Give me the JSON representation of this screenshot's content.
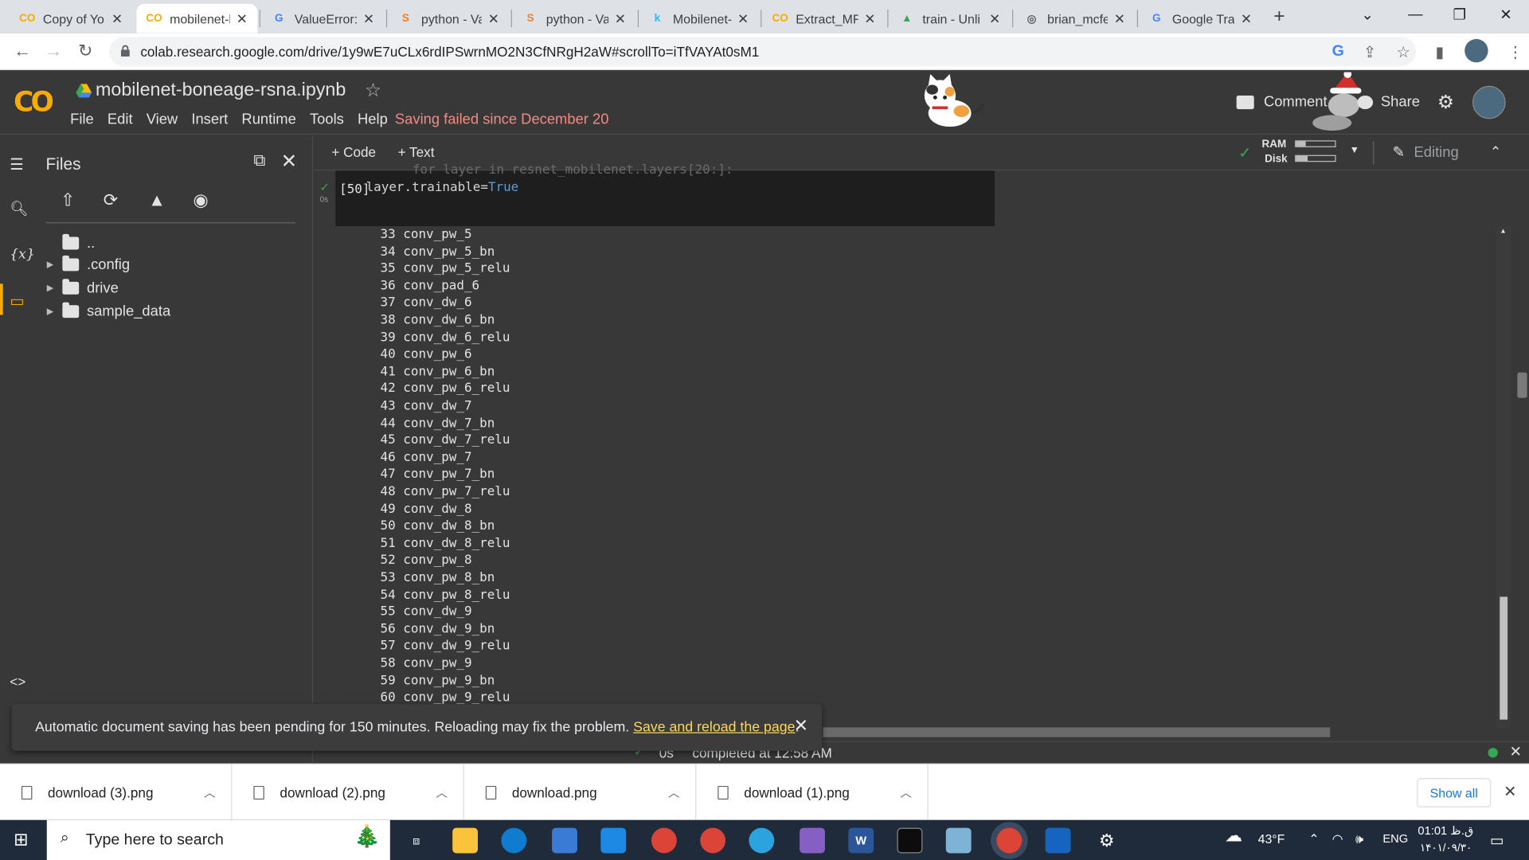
{
  "browser": {
    "tabs": [
      {
        "title": "Copy of Yo",
        "fav": "CO",
        "color": "#f9ab00"
      },
      {
        "title": "mobilenet-b",
        "fav": "CO",
        "color": "#f9ab00"
      },
      {
        "title": "ValueError:",
        "fav": "G",
        "color": "#4285f4"
      },
      {
        "title": "python - Va",
        "fav": "S",
        "color": "#f48024"
      },
      {
        "title": "python - Va",
        "fav": "S",
        "color": "#f48024"
      },
      {
        "title": "Mobilenet-b",
        "fav": "k",
        "color": "#20beff"
      },
      {
        "title": "Extract_MF",
        "fav": "CO",
        "color": "#f9ab00"
      },
      {
        "title": "train - Unli",
        "fav": "▲",
        "color": "#34a853"
      },
      {
        "title": "brian_mcfe",
        "fav": "◎",
        "color": "#5f6368"
      },
      {
        "title": "Google Tra",
        "fav": "G",
        "color": "#4285f4"
      }
    ],
    "url": "colab.research.google.com/drive/1y9wE7uCLx6rdIPSwrnMO2N3CfNRgH2aW#scrollTo=iTfVAYAt0sM1"
  },
  "colab": {
    "logo": "CO",
    "notebook_title": "mobilenet-boneage-rsna.ipynb",
    "menu": [
      "File",
      "Edit",
      "View",
      "Insert",
      "Runtime",
      "Tools",
      "Help"
    ],
    "save_status": "Saving failed since December 20",
    "comment_label": "Comment",
    "share_label": "Share",
    "code_label": "+ Code",
    "text_label": "+ Text",
    "ram_label": "RAM",
    "disk_label": "Disk",
    "ram_usage": 0.25,
    "disk_usage": 0.3,
    "editing_label": "Editing"
  },
  "files": {
    "title": "Files",
    "tree": [
      {
        "name": "..",
        "expandable": false
      },
      {
        "name": ".config",
        "expandable": true
      },
      {
        "name": "drive",
        "expandable": true
      },
      {
        "name": "sample_data",
        "expandable": true
      }
    ]
  },
  "cell": {
    "exec_count": "[50]",
    "exec_time": "0s",
    "code_line_1": "for layer in resnet_mobilenet.layers[20:]:",
    "code_line_2_prefix": "    layer.trainable=",
    "code_line_2_value": "True"
  },
  "output_lines": [
    "33 conv_pw_5",
    "34 conv_pw_5_bn",
    "35 conv_pw_5_relu",
    "36 conv_pad_6",
    "37 conv_dw_6",
    "38 conv_dw_6_bn",
    "39 conv_dw_6_relu",
    "40 conv_pw_6",
    "41 conv_pw_6_bn",
    "42 conv_pw_6_relu",
    "43 conv_dw_7",
    "44 conv_dw_7_bn",
    "45 conv_dw_7_relu",
    "46 conv_pw_7",
    "47 conv_pw_7_bn",
    "48 conv_pw_7_relu",
    "49 conv_dw_8",
    "50 conv_dw_8_bn",
    "51 conv_dw_8_relu",
    "52 conv_pw_8",
    "53 conv_pw_8_bn",
    "54 conv_pw_8_relu",
    "55 conv_dw_9",
    "56 conv_dw_9_bn",
    "57 conv_dw_9_relu",
    "58 conv_pw_9",
    "59 conv_pw_9_bn",
    "60 conv_pw_9_relu"
  ],
  "status": {
    "time": "0s",
    "completed": "completed at 12:58 AM"
  },
  "snackbar": {
    "message": "Automatic document saving has been pending for 150 minutes. Reloading may fix the problem.",
    "link": "Save and reload the page"
  },
  "downloads": {
    "items": [
      "download (3).png",
      "download (2).png",
      "download.png",
      "download (1).png"
    ],
    "show_all": "Show all"
  },
  "taskbar": {
    "search_placeholder": "Type here to search",
    "weather": "43°F",
    "lang": "ENG",
    "time": "01:01 ق.ظ",
    "date": "۱۴۰۱/۰۹/۳۰"
  }
}
